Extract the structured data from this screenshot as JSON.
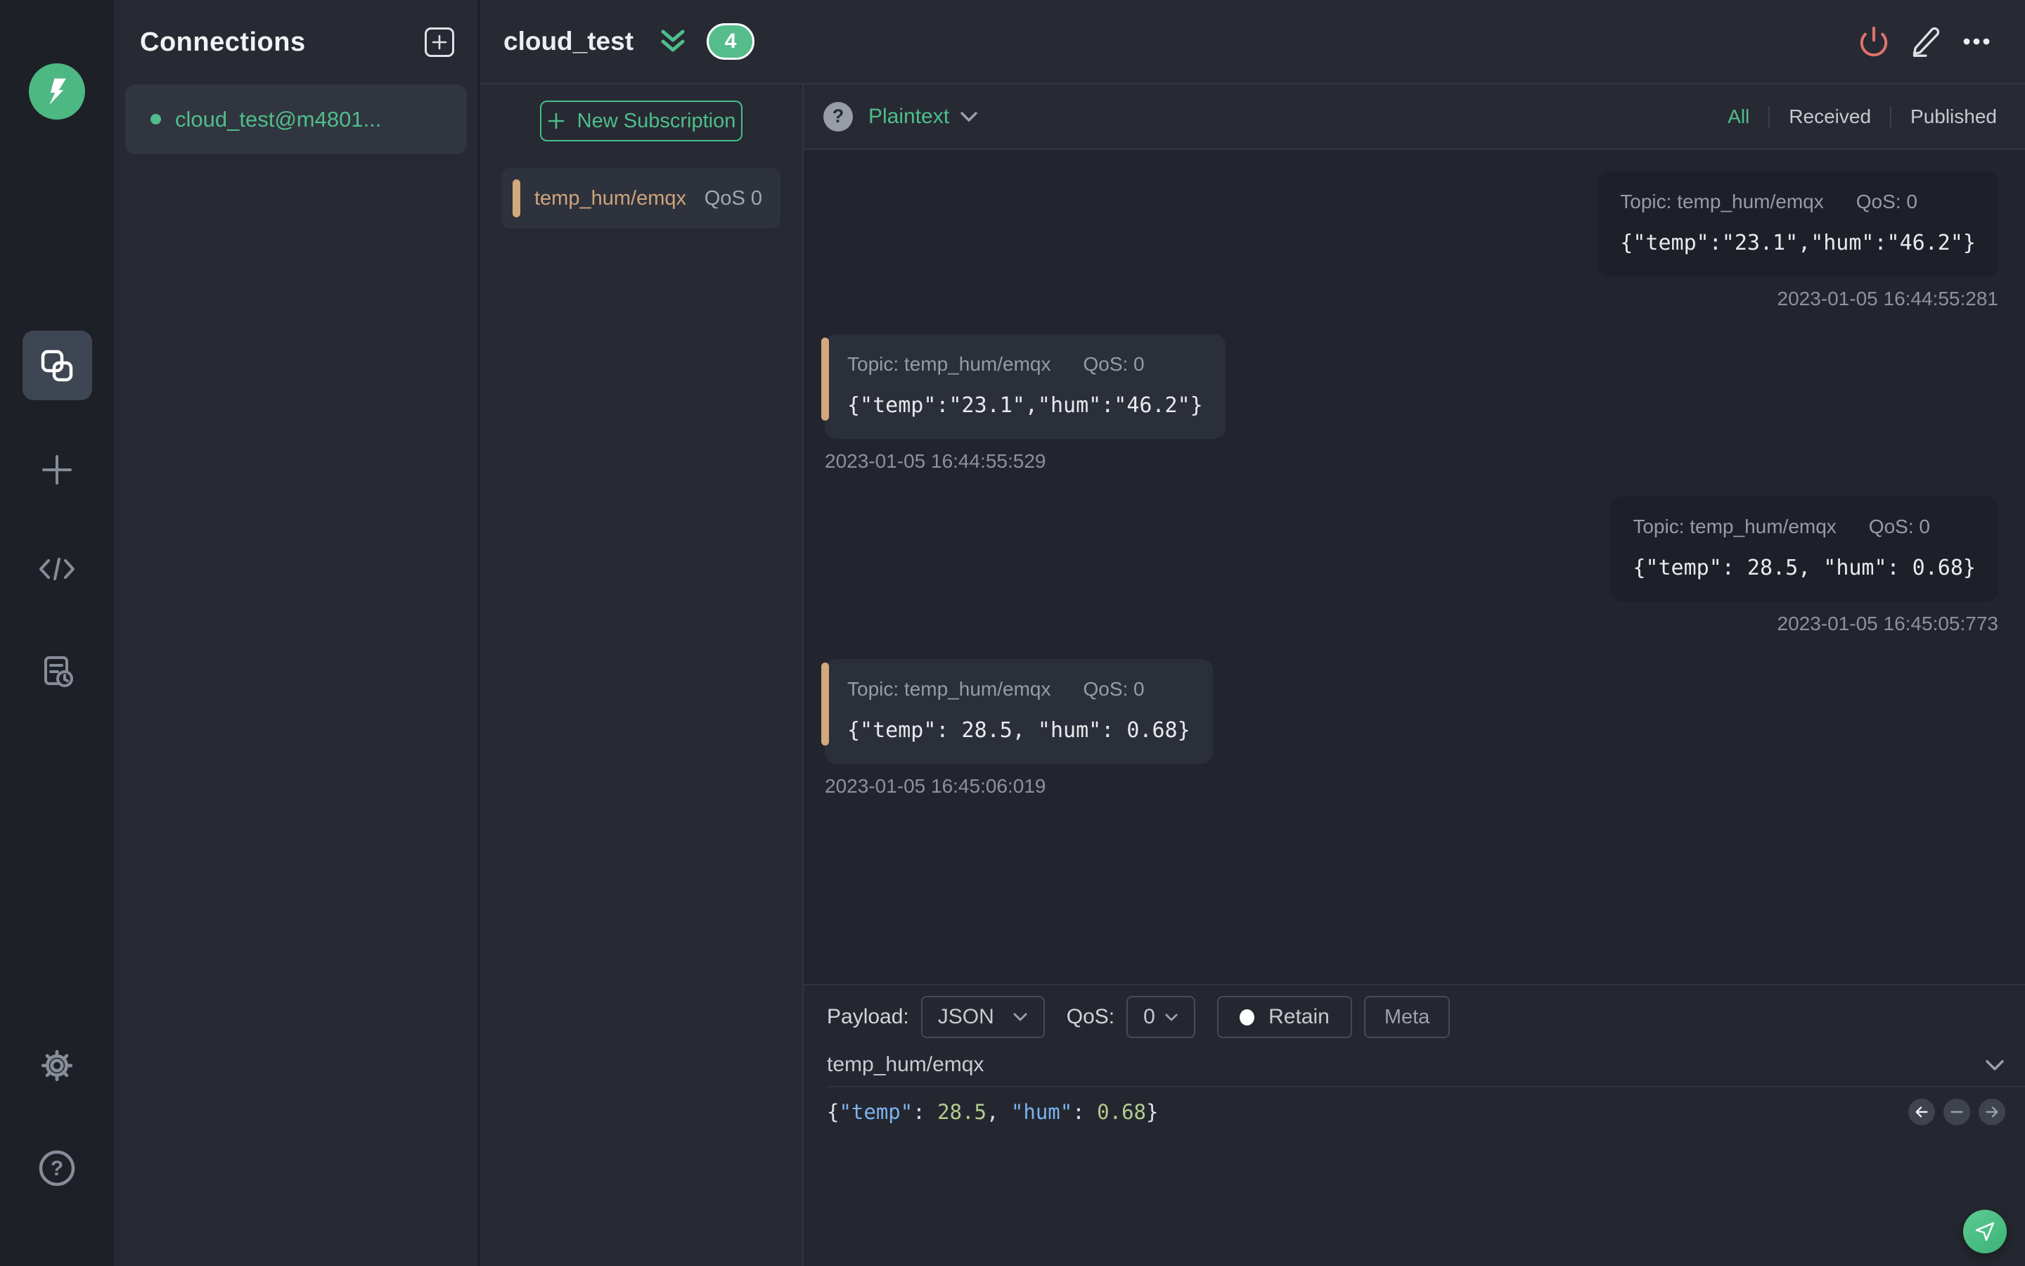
{
  "colors": {
    "accent_green": "#4fbe8b",
    "logo_green": "#4db882",
    "badge_green": "#55bd8b",
    "topic_tan": "#d2a87e",
    "power_red": "#e0736c",
    "syntax_key_blue": "#7db2ee",
    "syntax_num_green": "#b5cb8e"
  },
  "rail": {
    "icons": [
      "mqttx-logo",
      "overlapping-squares",
      "plus",
      "code",
      "log",
      "gear",
      "help"
    ]
  },
  "connections": {
    "title": "Connections",
    "items": [
      {
        "label": "cloud_test@m4801...",
        "status": "connected"
      }
    ]
  },
  "header": {
    "title": "cloud_test",
    "badge_count": "4"
  },
  "subscriptions": {
    "new_button": "New Subscription",
    "items": [
      {
        "topic": "temp_hum/emqx",
        "qos": "QoS 0"
      }
    ]
  },
  "messages": {
    "format_label": "Plaintext",
    "filters": {
      "all": "All",
      "received": "Received",
      "published": "Published",
      "active": "All"
    },
    "items": [
      {
        "direction": "published",
        "topic_label": "Topic: temp_hum/emqx",
        "qos_label": "QoS: 0",
        "payload": "{\"temp\":\"23.1\",\"hum\":\"46.2\"}",
        "timestamp": "2023-01-05 16:44:55:281"
      },
      {
        "direction": "received",
        "topic_label": "Topic: temp_hum/emqx",
        "qos_label": "QoS: 0",
        "payload": "{\"temp\":\"23.1\",\"hum\":\"46.2\"}",
        "timestamp": "2023-01-05 16:44:55:529"
      },
      {
        "direction": "published",
        "topic_label": "Topic: temp_hum/emqx",
        "qos_label": "QoS: 0",
        "payload": "{\"temp\": 28.5, \"hum\": 0.68}",
        "timestamp": "2023-01-05 16:45:05:773"
      },
      {
        "direction": "received",
        "topic_label": "Topic: temp_hum/emqx",
        "qos_label": "QoS: 0",
        "payload": "{\"temp\": 28.5, \"hum\": 0.68}",
        "timestamp": "2023-01-05 16:45:06:019"
      }
    ]
  },
  "publish": {
    "payload_label": "Payload:",
    "payload_format": "JSON",
    "qos_label": "QoS:",
    "qos_value": "0",
    "retain_label": "Retain",
    "meta_label": "Meta",
    "topic_value": "temp_hum/emqx",
    "payload_tokens": [
      {
        "type": "punct",
        "text": "{"
      },
      {
        "type": "key",
        "text": "\"temp\""
      },
      {
        "type": "punct",
        "text": ": "
      },
      {
        "type": "num",
        "text": "28.5"
      },
      {
        "type": "punct",
        "text": ", "
      },
      {
        "type": "key",
        "text": "\"hum\""
      },
      {
        "type": "punct",
        "text": ": "
      },
      {
        "type": "num",
        "text": "0.68"
      },
      {
        "type": "punct",
        "text": "}"
      }
    ]
  }
}
